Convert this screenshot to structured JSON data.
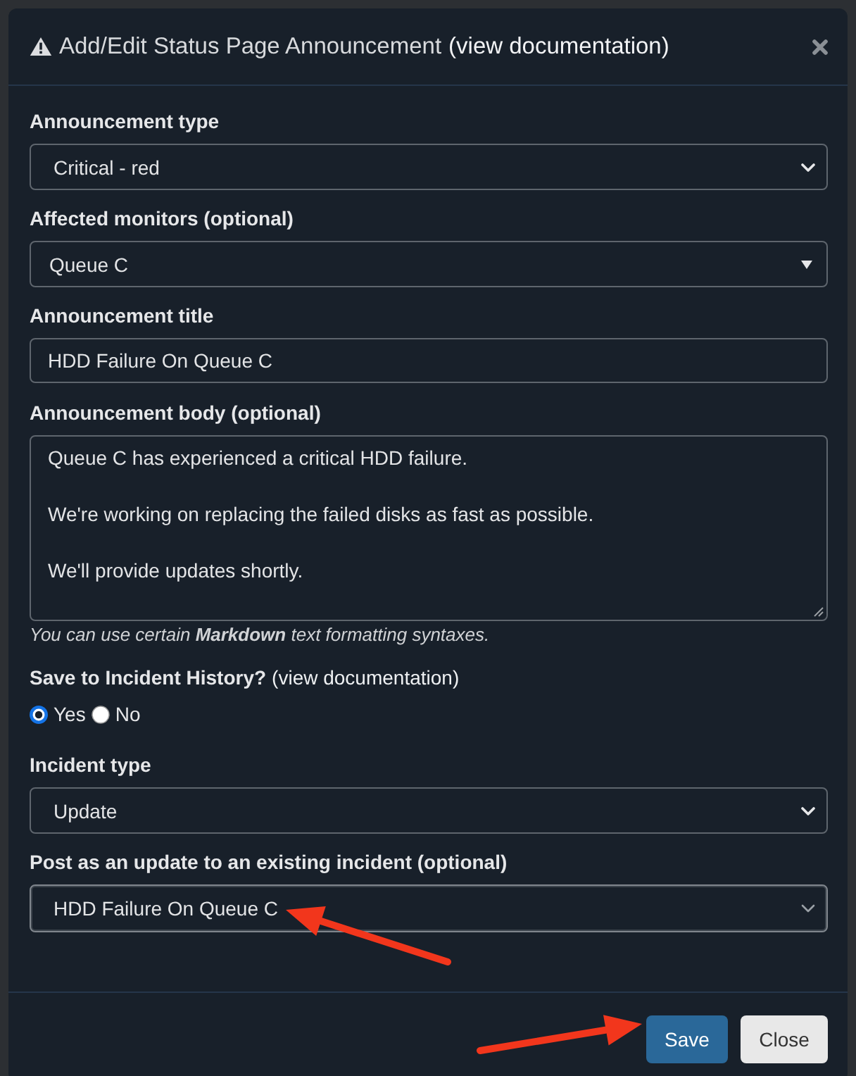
{
  "modal": {
    "title": "Add/Edit Status Page Announcement",
    "title_link": "(view documentation)"
  },
  "fields": [
    {
      "kind": "select",
      "label": "Announcement type",
      "value": "Critical - red",
      "focused": false
    },
    {
      "kind": "dropdown",
      "label": "Affected monitors (optional)",
      "value": "Queue C",
      "focused": false
    },
    {
      "kind": "input",
      "label": "Announcement title",
      "value": "HDD Failure On Queue C",
      "focused": false
    },
    {
      "kind": "textarea",
      "label": "Announcement body (optional)",
      "value": "Queue C has experienced a critical HDD failure.\n\nWe're working on replacing the failed disks as fast as possible.\n\nWe'll provide updates shortly.",
      "help": "You can use certain **Markdown** text formatting syntaxes.",
      "focused": false
    },
    {
      "kind": "radio",
      "label": "Save to Incident History?",
      "link": "(view documentation)",
      "options": [
        {
          "label": "Yes",
          "selected": true
        },
        {
          "label": "No",
          "selected": false
        }
      ]
    },
    {
      "kind": "select",
      "label": "Incident type",
      "value": "Update",
      "focused": false
    },
    {
      "kind": "select",
      "label": "Post as an update to an existing incident (optional)",
      "value": "HDD Failure On Queue C",
      "focused": true
    }
  ],
  "buttons": [
    {
      "kind": "primary",
      "label": "Save"
    },
    {
      "kind": "secondary",
      "label": "Close"
    }
  ]
}
